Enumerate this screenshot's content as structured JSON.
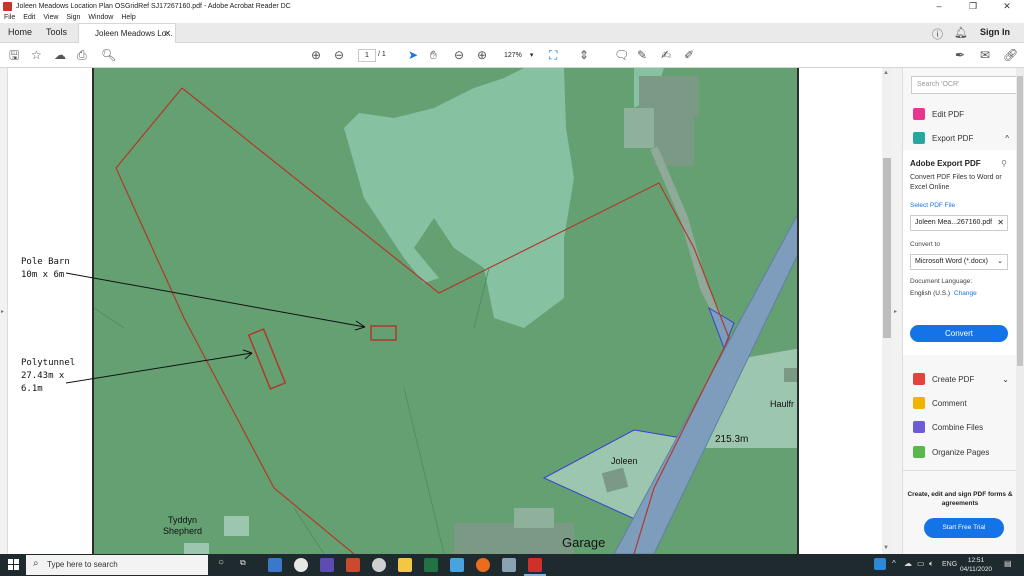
{
  "window": {
    "title": "Joleen Meadows Location Plan OSGridRef SJ17267160.pdf - Adobe Acrobat Reader DC",
    "controls": [
      "–",
      "❐",
      "✕"
    ]
  },
  "menu": [
    "File",
    "Edit",
    "View",
    "Sign",
    "Window",
    "Help"
  ],
  "tabs": {
    "home": "Home",
    "tools": "Tools",
    "doc": "Joleen Meadows Lo...",
    "sign_in": "Sign In"
  },
  "toolbar": {
    "page_current": "1",
    "page_total": "/ 1",
    "zoom": "127%"
  },
  "map": {
    "annotations": {
      "pole_barn": "Pole Barn\n10m x 6m",
      "polytunnel": "Polytunnel\n27.43m x\n6.1m"
    },
    "labels": {
      "haulfr": "Haulfr",
      "elevation": "215.3m",
      "joleen": "Joleen",
      "tyddyn": "Tyddyn\nShepherd",
      "garage": "Garage"
    },
    "colors": {
      "field": "#65a072",
      "woodland": "#86c2a2",
      "building": "#7a9a86",
      "road": "#7e9dbd",
      "boundary": "#b0392d"
    }
  },
  "panel": {
    "search_placeholder": "Search 'OCR'",
    "edit_pdf": "Edit PDF",
    "export_pdf": "Export PDF",
    "export_title": "Adobe Export PDF",
    "export_desc": "Convert PDF Files to Word or Excel Online",
    "select_file": "Select PDF File",
    "file_name": "Joleen Mea...267160.pdf",
    "convert_to": "Convert to",
    "format": "Microsoft Word (*.docx)",
    "doc_lang_label": "Document Language:",
    "doc_lang": "English (U.S.)",
    "change": "Change",
    "convert_btn": "Convert",
    "create_pdf": "Create PDF",
    "comment": "Comment",
    "combine_files": "Combine Files",
    "organize_pages": "Organize Pages",
    "promo": "Create, edit and sign PDF forms & agreements",
    "trial_btn": "Start Free Trial"
  },
  "taskbar": {
    "search_placeholder": "Type here to search",
    "lang": "ENG",
    "time": "12:51",
    "date": "04/11/2020"
  }
}
